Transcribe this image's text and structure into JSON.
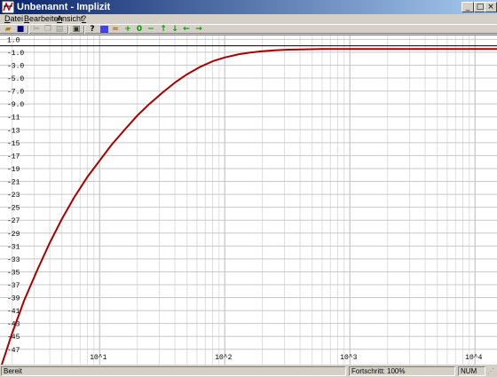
{
  "window": {
    "title": "Unbenannt - Implizit"
  },
  "menu": [
    {
      "label": "Datei",
      "accel": "D"
    },
    {
      "label": "Bearbeiten",
      "accel": "B"
    },
    {
      "label": "Ansicht",
      "accel": "A"
    },
    {
      "label": "?",
      "accel": "?"
    }
  ],
  "toolbar_icons": [
    "open-folder-icon",
    "save-icon",
    "cut-icon",
    "copy-icon",
    "paste-icon",
    "print-icon",
    "help-icon",
    "blue-square-icon",
    "graph-icon",
    "plus-icon",
    "zero-icon",
    "minus-icon",
    "arrow-up-icon",
    "arrow-down-icon",
    "arrow-left-icon",
    "arrow-right-icon"
  ],
  "status": {
    "left": "Bereit",
    "progress": "Fortschritt: 100%",
    "num": "NUM"
  },
  "colors": {
    "curve": "#a50000",
    "grid": "#c8c8c8",
    "axis": "#000000"
  },
  "chart_data": {
    "type": "line",
    "x_scale": "log",
    "xlim": [
      1.6,
      15000
    ],
    "ylim": [
      -49.5,
      1.6
    ],
    "x_tick_labels": [
      {
        "value": 10,
        "label": "10^1"
      },
      {
        "value": 100,
        "label": "10^2"
      },
      {
        "value": 1000,
        "label": "10^3"
      },
      {
        "value": 10000,
        "label": "10^4"
      }
    ],
    "y_tick_labels": [
      {
        "value": 1,
        "label": "1.0"
      },
      {
        "value": -1,
        "label": "-1.0"
      },
      {
        "value": -3,
        "label": "-3.0"
      },
      {
        "value": -5,
        "label": "-5.0"
      },
      {
        "value": -7,
        "label": "-7.0"
      },
      {
        "value": -9,
        "label": "-9.0"
      },
      {
        "value": -11,
        "label": "-11"
      },
      {
        "value": -13,
        "label": "-13"
      },
      {
        "value": -15,
        "label": "-15"
      },
      {
        "value": -17,
        "label": "-17"
      },
      {
        "value": -19,
        "label": "-19"
      },
      {
        "value": -21,
        "label": "-21"
      },
      {
        "value": -23,
        "label": "-23"
      },
      {
        "value": -25,
        "label": "-25"
      },
      {
        "value": -27,
        "label": "-27"
      },
      {
        "value": -29,
        "label": "-29"
      },
      {
        "value": -31,
        "label": "-31"
      },
      {
        "value": -33,
        "label": "-33"
      },
      {
        "value": -35,
        "label": "-35"
      },
      {
        "value": -37,
        "label": "-37"
      },
      {
        "value": -39,
        "label": "-39"
      },
      {
        "value": -41,
        "label": "-41"
      },
      {
        "value": -43,
        "label": "-43"
      },
      {
        "value": -45,
        "label": "-45"
      },
      {
        "value": -47,
        "label": "-47"
      }
    ],
    "series": [
      {
        "x": [
          1.65,
          2.0,
          2.5,
          3.2,
          4.0,
          5.0,
          6.3,
          8.0,
          10.0,
          12.5,
          16.0,
          20.0,
          25.0,
          32.0,
          40.0,
          50.0,
          63.0,
          80.0,
          100.0,
          130.0,
          160.0,
          200.0,
          250.0,
          320.0,
          400.0,
          600.0,
          1000.0,
          2000.0,
          5000.0,
          10000.0,
          15000.0
        ],
        "y": [
          -49.4,
          -44.5,
          -39.4,
          -34.6,
          -30.5,
          -26.8,
          -23.4,
          -20.3,
          -17.8,
          -15.3,
          -12.9,
          -10.8,
          -9.0,
          -7.2,
          -5.7,
          -4.4,
          -3.3,
          -2.4,
          -1.8,
          -1.3,
          -1.05,
          -0.85,
          -0.7,
          -0.6,
          -0.55,
          -0.5,
          -0.5,
          -0.5,
          -0.5,
          -0.5,
          -0.5
        ]
      }
    ]
  }
}
